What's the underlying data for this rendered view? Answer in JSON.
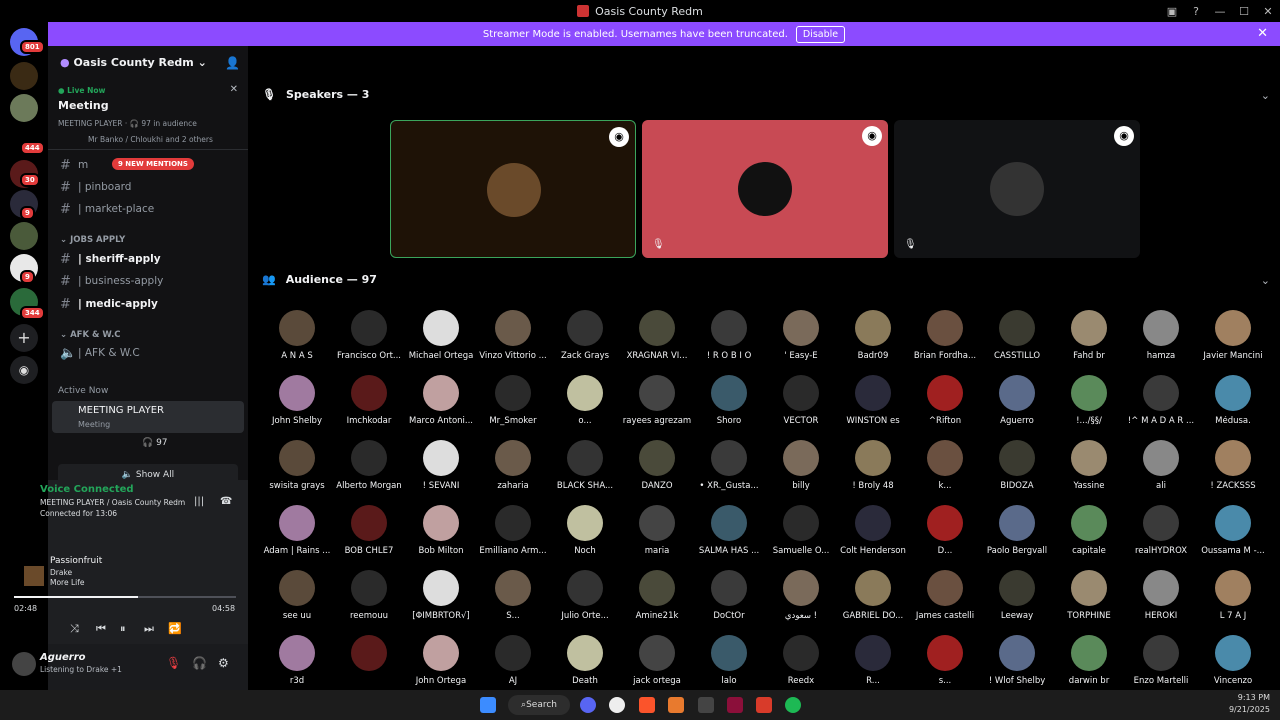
{
  "window": {
    "title": "Oasis County Redm"
  },
  "banner": {
    "text": "Streamer Mode is enabled. Usernames have been truncated.",
    "button": "Disable"
  },
  "guilds": {
    "badges": [
      "801",
      "444",
      "30",
      "9",
      "9",
      "344"
    ]
  },
  "sidebar": {
    "server_name": "Oasis County Redm",
    "live": {
      "label": "Live Now",
      "title": "Meeting",
      "stage": "MEETING PLAYER · 🎧 97 in audience",
      "speakers": "Mr Banko / Chloukhi and 2 others"
    },
    "mentions": "9 NEW MENTIONS",
    "channels_top": [
      {
        "label": "m",
        "name": "ch-m"
      },
      {
        "label": "| pinboard",
        "name": "ch-pinboard"
      },
      {
        "label": "| market-place",
        "name": "ch-market-place"
      }
    ],
    "cat_jobs": "JOBS APPLY",
    "jobs": [
      {
        "label": "| sheriff-apply",
        "bold": true
      },
      {
        "label": "| business-apply",
        "bold": false
      },
      {
        "label": "| medic-apply",
        "bold": true
      }
    ],
    "cat_afk": "AFK & W.C",
    "afk": "| AFK & W.C",
    "active_now": "Active Now",
    "stage_name": "MEETING PLAYER",
    "stage_sub": "Meeting",
    "stage_count": "97",
    "show_all": "Show All"
  },
  "voice": {
    "status": "Voice Connected",
    "channel": "MEETING PLAYER / Oasis County Redm",
    "connected": "Connected for 13:06",
    "song": "Passionfruit",
    "artist": "Drake",
    "album": "More Life",
    "elapsed": "02:48",
    "total": "04:58",
    "progress": 0.56
  },
  "user": {
    "name": "Aguerro",
    "status": "Listening to Drake +1"
  },
  "main": {
    "speakers_label": "Speakers — 3",
    "audience_label": "Audience — 97",
    "audience": [
      [
        "A N A S",
        "Francisco Ort...",
        "Michael Ortega",
        "Vinzo Vittorio ...",
        "Zack Grays",
        "XRAGNAR VI...",
        "! R O B I O",
        "' Easy-E",
        "Badr09",
        "Brian Fordha...",
        "CASSTILLO",
        "Fahd br",
        "hamza",
        "Javier Mancini"
      ],
      [
        "John Shelby",
        "Imchkodar",
        "Marco Antoni...",
        "Mr_Smoker",
        "o...",
        "rayees agrezam",
        "Shoro",
        "VECTOR",
        "WINSTON es",
        "^Rifton",
        "Aguerro",
        "!.../§§/",
        "!^ M A D A R ...",
        "Médusa."
      ],
      [
        "swisita grays",
        "Alberto Morgan",
        "! SEVANI",
        "zaharia",
        "BLACK SHA...",
        "DANZO",
        "• XR._Gusta...",
        "billy",
        "! Broly 48",
        "k...",
        "BIDOZA",
        "Yassine",
        "ali",
        "! ZACKSSS"
      ],
      [
        "Adam | Rains ...",
        "BOB CHLE7",
        "Bob Milton",
        "Emilliano Arm...",
        "Noch",
        "maria",
        "SALMA HAS ...",
        "Samuelle O...",
        "Colt Henderson",
        "D...",
        "Paolo Bergvall",
        "capitale",
        "realHYDROX",
        "Oussama M -..."
      ],
      [
        "see uu",
        "reemouu",
        "[ΦIMBRTOR√]",
        "S...",
        "Julio Orte...",
        "Amine21k",
        "DoCtOr",
        "سعودي !",
        "GABRIEL DO...",
        "James castelli",
        "Leeway",
        "TORPHINE",
        "HEROKI",
        "L 7 A J"
      ],
      [
        "r3d",
        "",
        "John Ortega",
        "AJ",
        "Death",
        "jack ortega",
        "lalo",
        "Reedx",
        "R...",
        "s...",
        "! Wlof Shelby",
        "darwin br",
        "Enzo Martelli",
        "Vincenzo"
      ]
    ]
  },
  "taskbar": {
    "search": "Search",
    "time": "9:13 PM",
    "date": "9/21/2025"
  }
}
